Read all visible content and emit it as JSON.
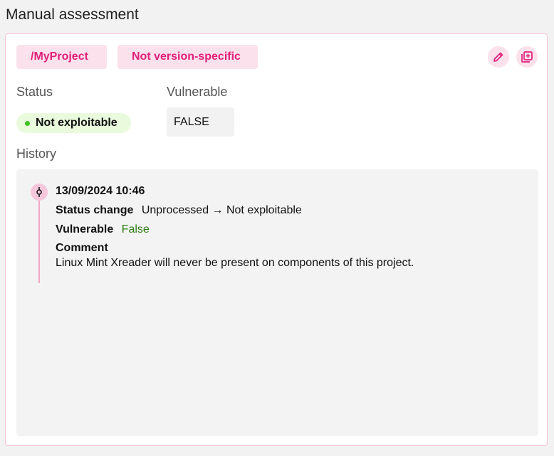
{
  "page": {
    "title": "Manual assessment"
  },
  "chips": {
    "project": "/MyProject",
    "version": "Not version-specific"
  },
  "actions": {
    "edit_icon": "pencil-icon",
    "duplicate_icon": "duplicate-icon"
  },
  "status": {
    "label": "Status",
    "value": "Not exploitable",
    "dot_color": "#3cc41e"
  },
  "vulnerable": {
    "label": "Vulnerable",
    "value": "FALSE"
  },
  "history": {
    "label": "History",
    "entries": [
      {
        "timestamp": "13/09/2024 10:46",
        "status_change_label": "Status change",
        "status_change_value": "Unprocessed → Not exploitable",
        "vulnerable_label": "Vulnerable",
        "vulnerable_value": "False",
        "comment_label": "Comment",
        "comment_text": "Linux Mint Xreader will never be present on components of this project."
      }
    ]
  },
  "colors": {
    "accent": "#e0217a",
    "chip_bg": "#fbe1ec",
    "timeline": "#f1a9c5"
  }
}
